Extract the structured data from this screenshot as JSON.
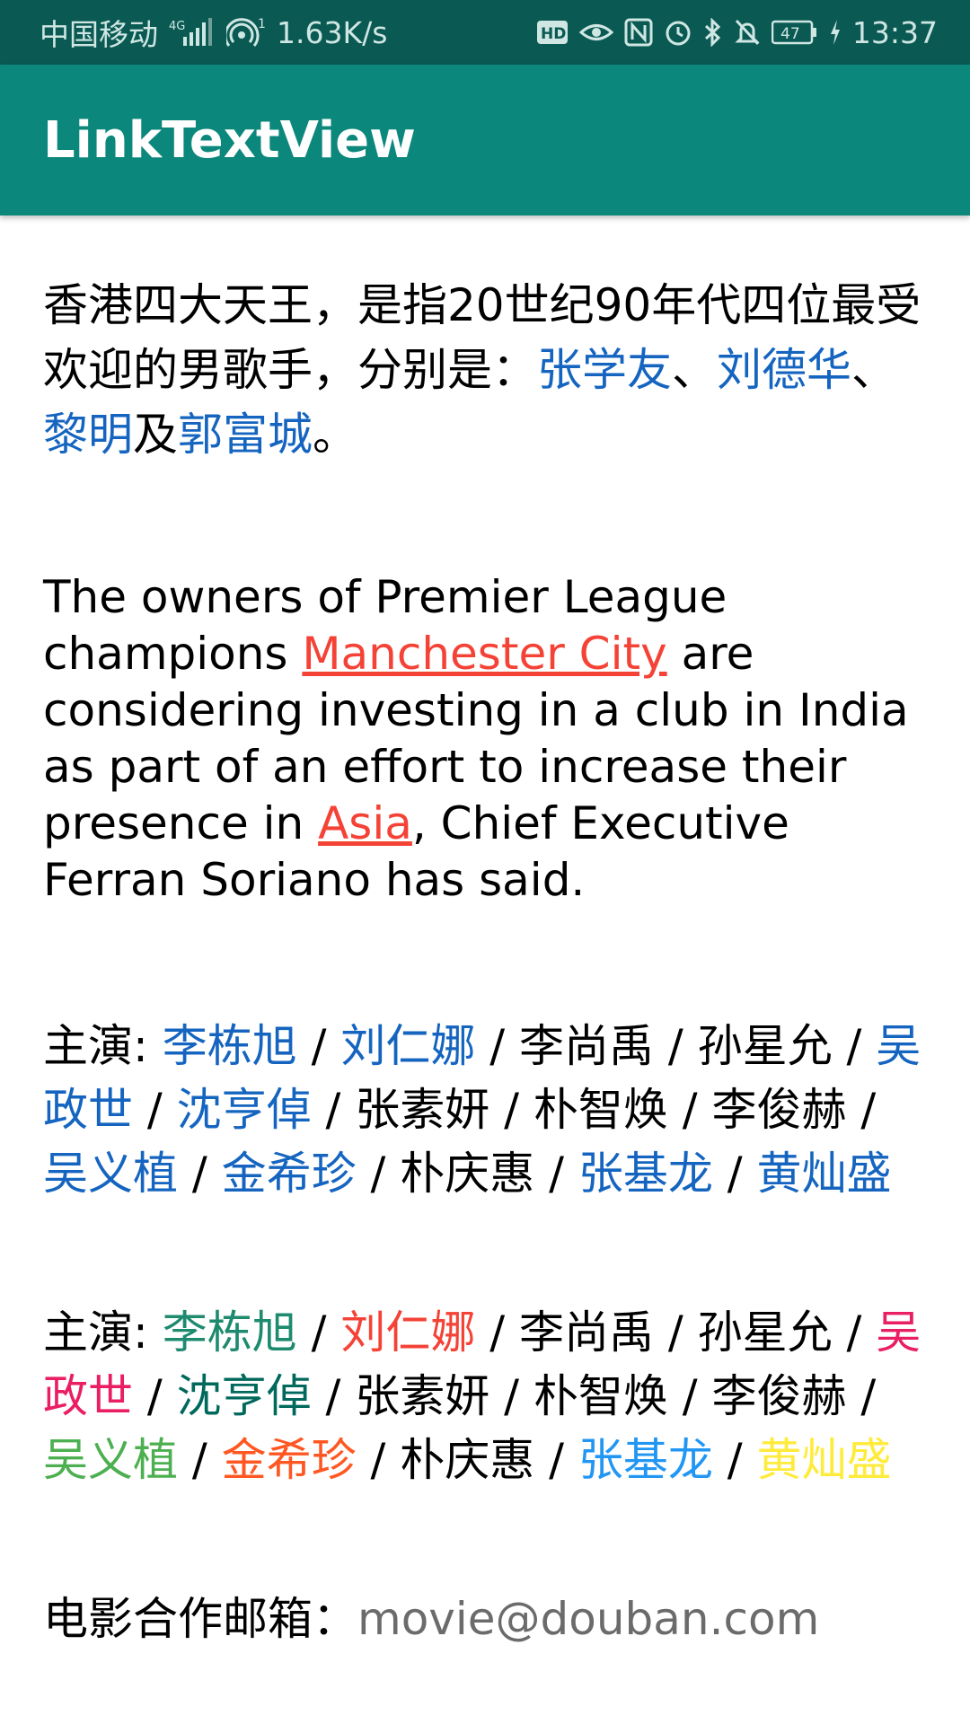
{
  "status_bar": {
    "carrier": "中国移动",
    "network": "4G",
    "hotspot_count": "1",
    "speed": "1.63K/s",
    "hd_badge": "HD",
    "battery": "47",
    "time": "13:37",
    "icons": [
      "signal-icon",
      "hotspot-icon",
      "hd-icon",
      "eye-icon",
      "nfc-icon",
      "alarm-icon",
      "bluetooth-icon",
      "mute-icon",
      "battery-icon",
      "charging-icon"
    ]
  },
  "app_bar": {
    "title": "LinkTextView",
    "color": "#0b877b"
  },
  "p1": {
    "t1": "香港四大天王，是指20世纪90年代四位最受欢迎的男歌手，分别是：",
    "link1": "张学友",
    "sep1": "、",
    "link2": "刘德华",
    "sep2": "、",
    "link3": "黎明",
    "sep3": "及",
    "link4": "郭富城",
    "end": "。",
    "link_color": "#1565c0"
  },
  "p2": {
    "t1": "The owners of Premier League champions ",
    "link1": "Manchester City",
    "t2": " are considering investing in a club in India as part of an effort to increase their presence in ",
    "link2": "Asia",
    "t3": ", Chief Executive Ferran Soriano has said.",
    "link_color": "#f44336"
  },
  "p3": {
    "segments": [
      {
        "text": "主演: ",
        "link": false
      },
      {
        "text": "李栋旭",
        "link": true
      },
      {
        "text": " / ",
        "link": false
      },
      {
        "text": "刘仁娜",
        "link": true
      },
      {
        "text": " / 李尚禹 / 孙星允 / ",
        "link": false
      },
      {
        "text": "吴政世",
        "link": true
      },
      {
        "text": " / ",
        "link": false
      },
      {
        "text": "沈亨倬",
        "link": true
      },
      {
        "text": " / 张素妍 / 朴智焕 / 李俊赫 / ",
        "link": false
      },
      {
        "text": "吴义植",
        "link": true
      },
      {
        "text": " / ",
        "link": false
      },
      {
        "text": "金希珍",
        "link": true
      },
      {
        "text": " / 朴庆惠 / ",
        "link": false
      },
      {
        "text": "张基龙",
        "link": true
      },
      {
        "text": " / ",
        "link": false
      },
      {
        "text": "黄灿盛",
        "link": true
      }
    ],
    "link_color": "#1565c0"
  },
  "p4": {
    "segments": [
      {
        "text": "主演: ",
        "color": ""
      },
      {
        "text": "李栋旭",
        "color": "#1e8a6e"
      },
      {
        "text": " / ",
        "color": ""
      },
      {
        "text": "刘仁娜",
        "color": "#f44336"
      },
      {
        "text": " / 李尚禹 / 孙星允 / ",
        "color": ""
      },
      {
        "text": "吴政世",
        "color": "#e91e63"
      },
      {
        "text": " / ",
        "color": ""
      },
      {
        "text": "沈亨倬",
        "color": "#00695c"
      },
      {
        "text": " / 张素妍 / 朴智焕 / 李俊赫 / ",
        "color": ""
      },
      {
        "text": "吴义植",
        "color": "#4caf50"
      },
      {
        "text": " / ",
        "color": ""
      },
      {
        "text": "金希珍",
        "color": "#ff5722"
      },
      {
        "text": " / 朴庆惠 / ",
        "color": ""
      },
      {
        "text": "张基龙",
        "color": "#2196f3"
      },
      {
        "text": " / ",
        "color": ""
      },
      {
        "text": "黄灿盛",
        "color": "#ffeb3b"
      }
    ]
  },
  "p5": {
    "label": "电影合作邮箱：",
    "email": "movie@douban.com"
  }
}
